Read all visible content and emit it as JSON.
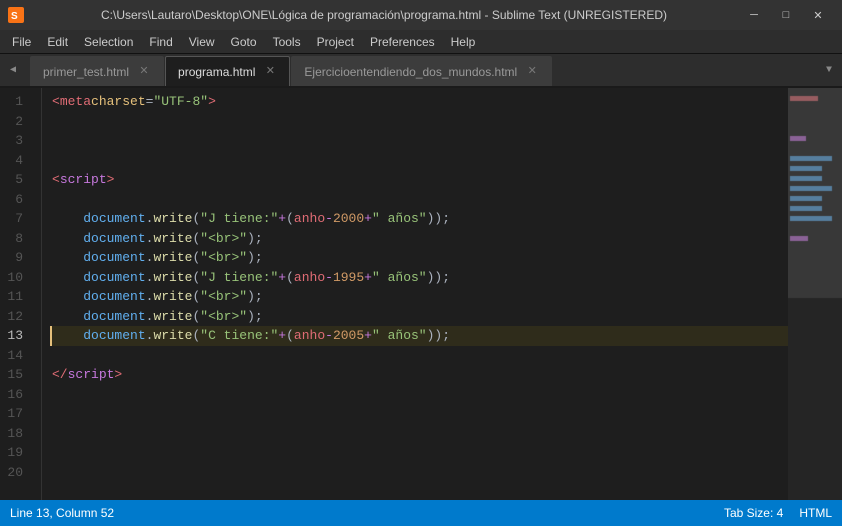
{
  "titlebar": {
    "icon": "ST",
    "title": "C:\\Users\\Lautaro\\Desktop\\ONE\\Lógica de programación\\programa.html - Sublime Text (UNREGISTERED)",
    "minimize": "─",
    "maximize": "□",
    "close": "✕"
  },
  "menubar": {
    "items": [
      "File",
      "Edit",
      "Selection",
      "Find",
      "View",
      "Goto",
      "Tools",
      "Project",
      "Preferences",
      "Help"
    ]
  },
  "tabs": [
    {
      "label": "primer_test.html",
      "active": false
    },
    {
      "label": "programa.html",
      "active": true
    },
    {
      "label": "Ejercicioentendiendo_dos_mundos.html",
      "active": false
    }
  ],
  "statusbar": {
    "position": "Line 13, Column 52",
    "tab_size": "Tab Size: 4",
    "language": "HTML"
  },
  "lines": [
    1,
    2,
    3,
    4,
    5,
    6,
    7,
    8,
    9,
    10,
    11,
    12,
    13,
    14,
    15,
    16,
    17,
    18,
    19,
    20
  ]
}
